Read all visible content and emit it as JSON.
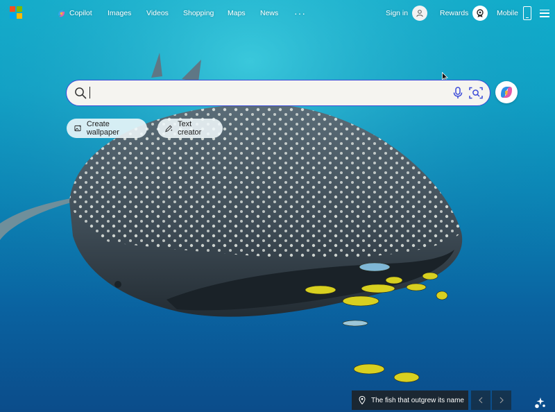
{
  "colors": {
    "ms_red": "#f25022",
    "ms_green": "#7fba00",
    "ms_blue": "#00a4ef",
    "ms_yellow": "#ffb900",
    "search_border": "#3b4ad8"
  },
  "nav": {
    "items": [
      {
        "label": "Copilot",
        "icon": "copilot-icon"
      },
      {
        "label": "Images"
      },
      {
        "label": "Videos"
      },
      {
        "label": "Shopping"
      },
      {
        "label": "Maps"
      },
      {
        "label": "News"
      }
    ],
    "more": "···"
  },
  "account": {
    "sign_in": "Sign in",
    "rewards": "Rewards",
    "mobile": "Mobile"
  },
  "search": {
    "value": "",
    "placeholder": ""
  },
  "chips": [
    {
      "label": "Create wallpaper",
      "icon": "image-sparkle-icon"
    },
    {
      "label": "Text creator",
      "icon": "pen-sparkle-icon"
    }
  ],
  "image_info": {
    "caption": "The fish that outgrew its name",
    "icon": "location-pin-icon"
  }
}
